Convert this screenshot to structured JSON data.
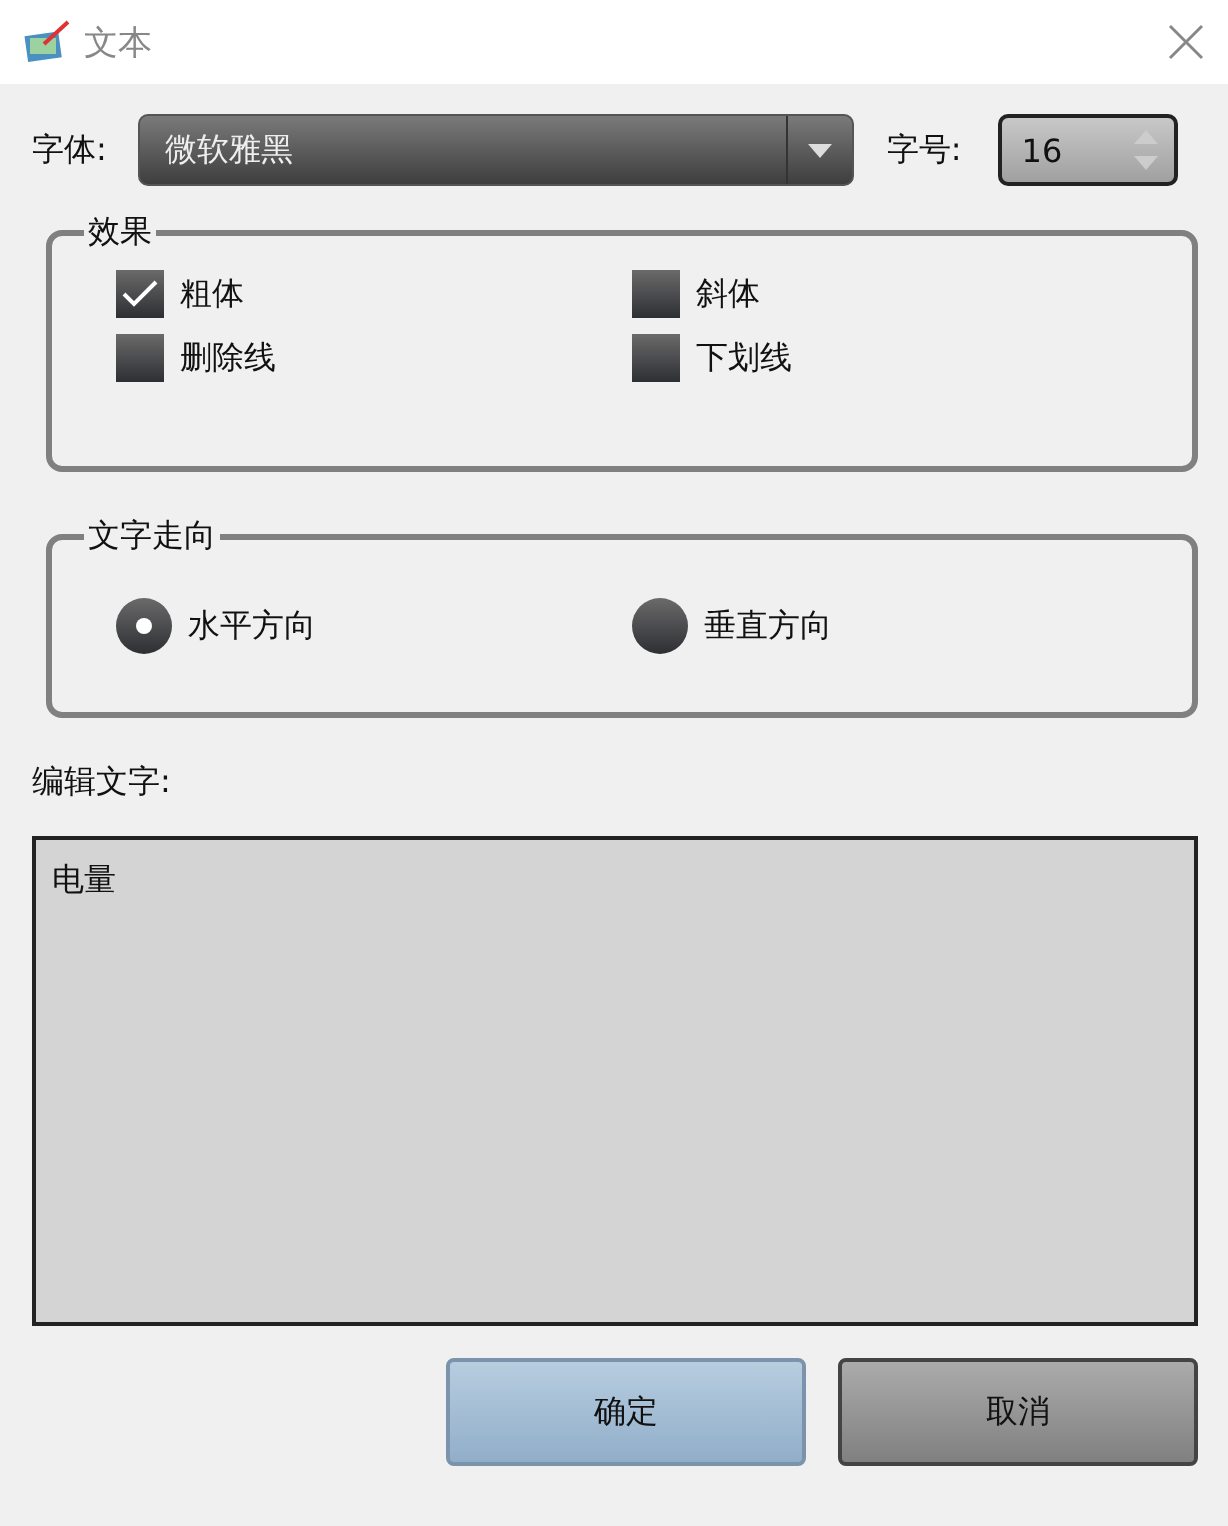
{
  "window": {
    "title": "文本"
  },
  "font": {
    "label": "字体:",
    "value": "微软雅黑"
  },
  "size": {
    "label": "字号:",
    "value": "16"
  },
  "effects": {
    "title": "效果",
    "options": [
      {
        "label": "粗体",
        "checked": true
      },
      {
        "label": "斜体",
        "checked": false
      },
      {
        "label": "删除线",
        "checked": false
      },
      {
        "label": "下划线",
        "checked": false
      }
    ]
  },
  "direction": {
    "title": "文字走向",
    "options": [
      {
        "label": "水平方向",
        "selected": true
      },
      {
        "label": "垂直方向",
        "selected": false
      }
    ]
  },
  "edit": {
    "label": "编辑文字:",
    "value": "电量"
  },
  "buttons": [
    {
      "label": "确定",
      "kind": "primary"
    },
    {
      "label": "取消",
      "kind": "secondary"
    }
  ]
}
